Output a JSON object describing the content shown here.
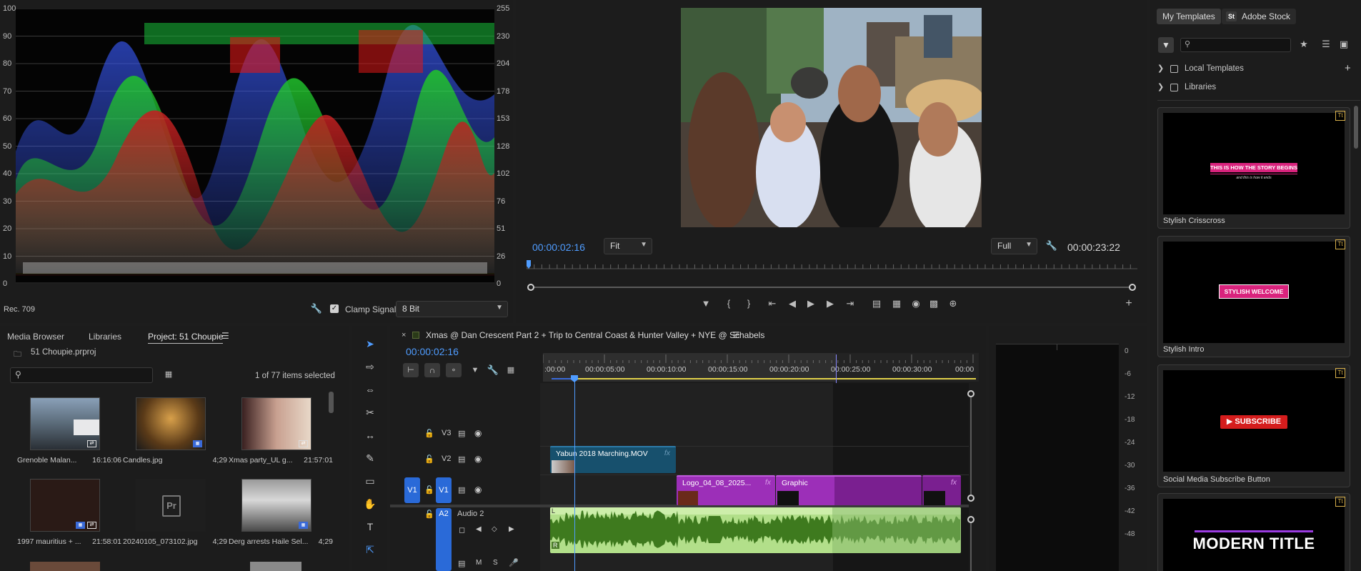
{
  "scope": {
    "left_scale": [
      "100",
      "90",
      "80",
      "70",
      "60",
      "50",
      "40",
      "30",
      "20",
      "10",
      "0"
    ],
    "right_scale": [
      "255",
      "230",
      "204",
      "178",
      "153",
      "128",
      "102",
      "76",
      "51",
      "26",
      "0"
    ],
    "colorspace": "Rec. 709",
    "clamp_label": "Clamp Signal",
    "bit_depth": "8 Bit"
  },
  "program": {
    "timecode_current": "00:00:02:16",
    "timecode_duration": "00:00:23:22",
    "fit_value": "Fit",
    "resolution_value": "Full"
  },
  "templates": {
    "tab_my": "My Templates",
    "tab_stock": "Adobe Stock",
    "stock_badge": "St",
    "tree": [
      {
        "label": "Local Templates"
      },
      {
        "label": "Libraries"
      }
    ],
    "cards": [
      {
        "name": "Stylish Crisscross",
        "text": "THIS IS HOW THE STORY BEGINS",
        "sub": "and this is how it ends"
      },
      {
        "name": "Stylish Intro",
        "text": "STYLISH WELCOME"
      },
      {
        "name": "Social Media Subscribe Button",
        "text": "SUBSCRIBE"
      },
      {
        "name": "",
        "text": "MODERN TITLE"
      }
    ]
  },
  "project": {
    "tabs": [
      "Media Browser",
      "Libraries",
      "Project: 51 Choupie"
    ],
    "file_name": "51 Choupie.prproj",
    "selection_status": "1 of 77 items selected",
    "pr_glyph": "Pr",
    "items": [
      {
        "name": "Grenoble Malan...",
        "duration": "16:16:06"
      },
      {
        "name": "Candles.jpg",
        "duration": "4;29"
      },
      {
        "name": "Xmas party_UL g...",
        "duration": "21:57:01"
      },
      {
        "name": "1997 mauritius + ...",
        "duration": "21:58:01"
      },
      {
        "name": "20240105_073102.jpg",
        "duration": "4;29"
      },
      {
        "name": "Derg arrests Haile Sel...",
        "duration": "4;29"
      }
    ]
  },
  "timeline": {
    "sequence_name": "Xmas @ Dan Crescent Part 2 + Trip to Central Coast & Hunter Valley + NYE @ Schabels",
    "timecode": "00:00:02:16",
    "ruler": [
      ":00:00",
      "00:00:05:00",
      "00:00:10:00",
      "00:00:15:00",
      "00:00:20:00",
      "00:00:25:00",
      "00:00:30:00",
      "00:00"
    ],
    "tracks": {
      "v3": "V3",
      "v2": "V2",
      "v1": "V1",
      "a2": "A2",
      "a2_name": "Audio 2",
      "m": "M",
      "s": "S"
    },
    "clips": {
      "v2_clip": "Yabun 2018 Marching.MOV",
      "v1_logo": "Logo_04_08_2025...",
      "v1_graphic": "Graphic",
      "fx": "fx"
    }
  },
  "meters": {
    "scale": [
      "0",
      "-6",
      "-12",
      "-18",
      "-24",
      "-30",
      "-36",
      "-42",
      "-48"
    ]
  }
}
